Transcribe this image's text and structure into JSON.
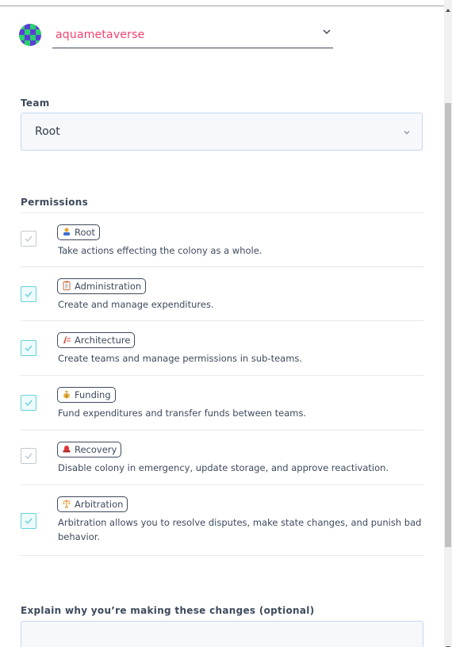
{
  "user": {
    "name": "aquametaverse"
  },
  "team": {
    "label": "Team",
    "selected": "Root"
  },
  "permissions": {
    "label": "Permissions",
    "items": [
      {
        "name": "Root",
        "icon": "root-icon",
        "description": "Take actions effecting the colony as a whole.",
        "checked": true,
        "disabled": true
      },
      {
        "name": "Administration",
        "icon": "administration-icon",
        "description": "Create and manage expenditures.",
        "checked": true,
        "disabled": false
      },
      {
        "name": "Architecture",
        "icon": "architecture-icon",
        "description": "Create teams and manage permissions in sub-teams.",
        "checked": true,
        "disabled": false
      },
      {
        "name": "Funding",
        "icon": "funding-icon",
        "description": "Fund expenditures and transfer funds between teams.",
        "checked": true,
        "disabled": false
      },
      {
        "name": "Recovery",
        "icon": "recovery-icon",
        "description": "Disable colony in emergency, update storage, and approve reactivation.",
        "checked": true,
        "disabled": true
      },
      {
        "name": "Arbitration",
        "icon": "arbitration-icon",
        "description": "Arbitration allows you to resolve disputes, make state changes, and punish bad behavior.",
        "checked": true,
        "disabled": false
      }
    ]
  },
  "explain": {
    "label": "Explain why you’re making these changes (optional)",
    "value": ""
  },
  "colors": {
    "accent_pink": "#f5416d",
    "check_teal": "#64d2da",
    "disabled_gray": "#c3c9d0",
    "text": "#3d4a5c"
  }
}
